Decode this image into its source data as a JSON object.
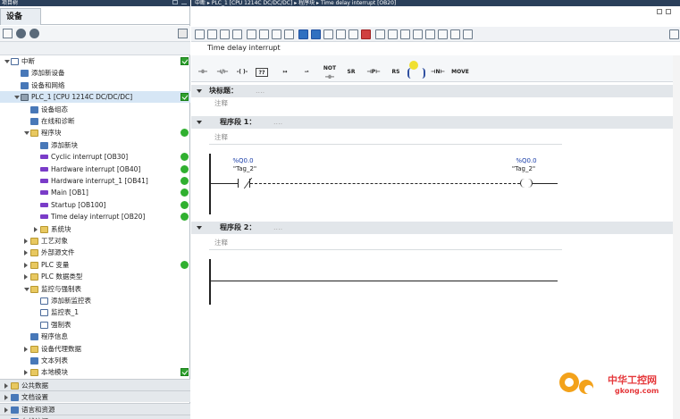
{
  "left_panel": {
    "title_truncated": "项目树",
    "tab_label": "设备",
    "tree": [
      {
        "label": "中断",
        "indent": 0,
        "arrow": "down",
        "icon": "project-icon",
        "status": "check"
      },
      {
        "label": "添加新设备",
        "indent": 1,
        "arrow": "",
        "icon": "add-device-icon",
        "status": ""
      },
      {
        "label": "设备和网络",
        "indent": 1,
        "arrow": "",
        "icon": "network-icon",
        "status": ""
      },
      {
        "label": "PLC_1 [CPU 1214C DC/DC/DC]",
        "indent": 1,
        "arrow": "down",
        "icon": "plc-icon",
        "status": "check",
        "selected": true
      },
      {
        "label": "设备组态",
        "indent": 2,
        "arrow": "",
        "icon": "device-config-icon",
        "status": ""
      },
      {
        "label": "在线和诊断",
        "indent": 2,
        "arrow": "",
        "icon": "diagnostics-icon",
        "status": ""
      },
      {
        "label": "程序块",
        "indent": 2,
        "arrow": "down",
        "icon": "folder-icon",
        "status": "dot"
      },
      {
        "label": "添加新块",
        "indent": 3,
        "arrow": "",
        "icon": "add-block-icon",
        "status": ""
      },
      {
        "label": "Cyclic interrupt [OB30]",
        "indent": 3,
        "arrow": "",
        "icon": "ob-block-icon",
        "status": "dot"
      },
      {
        "label": "Hardware interrupt [OB40]",
        "indent": 3,
        "arrow": "",
        "icon": "ob-block-icon",
        "status": "dot"
      },
      {
        "label": "Hardware interrupt_1 [OB41]",
        "indent": 3,
        "arrow": "",
        "icon": "ob-block-icon",
        "status": "dot"
      },
      {
        "label": "Main [OB1]",
        "indent": 3,
        "arrow": "",
        "icon": "ob-block-icon",
        "status": "dot"
      },
      {
        "label": "Startup [OB100]",
        "indent": 3,
        "arrow": "",
        "icon": "ob-block-icon",
        "status": "dot"
      },
      {
        "label": "Time delay interrupt [OB20]",
        "indent": 3,
        "arrow": "",
        "icon": "ob-block-icon",
        "status": "dot"
      },
      {
        "label": "系统块",
        "indent": 3,
        "arrow": "right",
        "icon": "folder-icon",
        "status": ""
      },
      {
        "label": "工艺对象",
        "indent": 2,
        "arrow": "right",
        "icon": "folder-icon",
        "status": ""
      },
      {
        "label": "外部源文件",
        "indent": 2,
        "arrow": "right",
        "icon": "folder-icon",
        "status": ""
      },
      {
        "label": "PLC 变量",
        "indent": 2,
        "arrow": "right",
        "icon": "folder-icon",
        "status": "dot"
      },
      {
        "label": "PLC 数据类型",
        "indent": 2,
        "arrow": "right",
        "icon": "folder-icon",
        "status": ""
      },
      {
        "label": "监控与强制表",
        "indent": 2,
        "arrow": "down",
        "icon": "folder-icon",
        "status": ""
      },
      {
        "label": "添加新监控表",
        "indent": 3,
        "arrow": "",
        "icon": "add-table-icon",
        "status": ""
      },
      {
        "label": "监控表_1",
        "indent": 3,
        "arrow": "",
        "icon": "watch-table-icon",
        "status": ""
      },
      {
        "label": "强制表",
        "indent": 3,
        "arrow": "",
        "icon": "force-table-icon",
        "status": ""
      },
      {
        "label": "程序信息",
        "indent": 2,
        "arrow": "",
        "icon": "program-info-icon",
        "status": ""
      },
      {
        "label": "设备代理数据",
        "indent": 2,
        "arrow": "right",
        "icon": "folder-icon",
        "status": ""
      },
      {
        "label": "文本列表",
        "indent": 2,
        "arrow": "",
        "icon": "text-list-icon",
        "status": ""
      },
      {
        "label": "本地模块",
        "indent": 2,
        "arrow": "right",
        "icon": "folder-icon",
        "status": "check"
      },
      {
        "label": "公共数据",
        "indent": 0,
        "arrow": "right",
        "icon": "folder-icon",
        "status": "",
        "section": true
      },
      {
        "label": "文档设置",
        "indent": 0,
        "arrow": "right",
        "icon": "doc-settings-icon",
        "status": "",
        "section": true
      },
      {
        "label": "语言和资源",
        "indent": 0,
        "arrow": "right",
        "icon": "language-icon",
        "status": "",
        "section": true
      },
      {
        "label": "在线访问",
        "indent": 0,
        "arrow": "right",
        "icon": "online-icon",
        "status": "",
        "section": true
      }
    ]
  },
  "editor": {
    "breadcrumb": "中断 ▸ PLC_1 [CPU 1214C DC/DC/DC] ▸ 程序块 ▸ Time delay interrupt [OB20]",
    "block_title": "Time delay interrupt",
    "instructions": [
      "NOT",
      "SR",
      "RS",
      "MOVE"
    ],
    "block_header": {
      "label": "块标题：",
      "placeholder": "....",
      "comment": "注释"
    },
    "networks": [
      {
        "label": "程序段 1：",
        "placeholder": "....",
        "comment": "注释",
        "contact": {
          "address": "%Q0.0",
          "tag": "\"Tag_2\""
        },
        "coil": {
          "address": "%Q0.0",
          "tag": "\"Tag_2\""
        }
      },
      {
        "label": "程序段 2：",
        "placeholder": "....",
        "comment": "注释"
      }
    ]
  },
  "watermark": {
    "brand": "中华工控网",
    "url": "gkong.com"
  },
  "colors": {
    "selection": "#d6e6f5",
    "status_ok": "#30b030",
    "title_bar": "#2a3f5a",
    "operand_blue": "#1a3ea8"
  }
}
